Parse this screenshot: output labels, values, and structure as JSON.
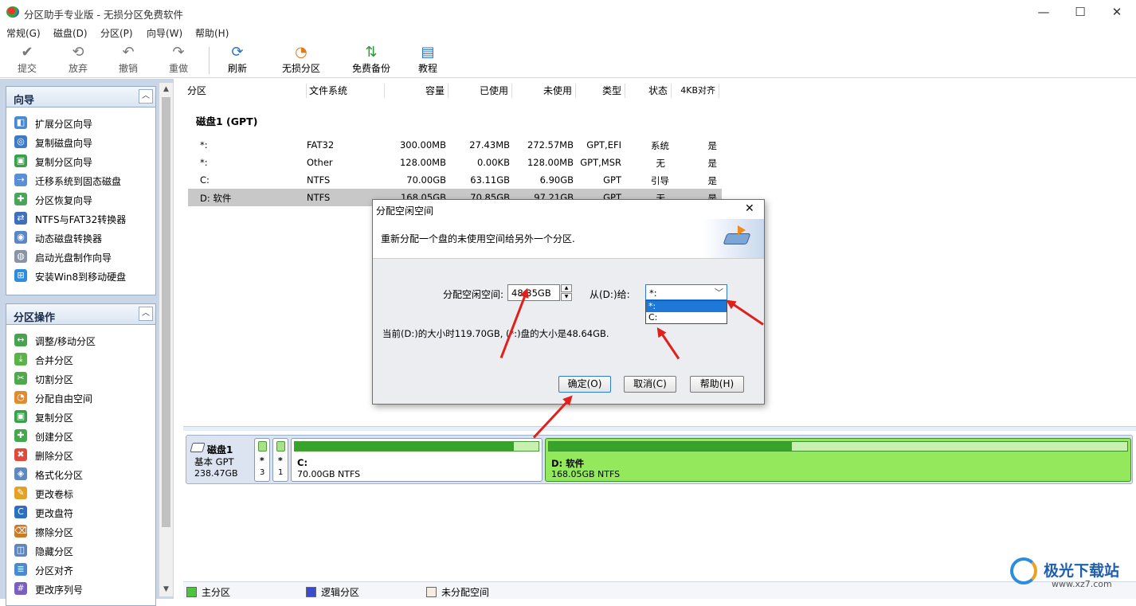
{
  "window": {
    "title": "分区助手专业版 - 无损分区免费软件",
    "min": "—",
    "max": "☐",
    "close": "✕"
  },
  "menu": [
    "常规(G)",
    "磁盘(D)",
    "分区(P)",
    "向导(W)",
    "帮助(H)"
  ],
  "toolbar": [
    {
      "label": "提交",
      "icon": "check-icon",
      "glyph": "✔",
      "enabled": false
    },
    {
      "label": "放弃",
      "icon": "discard-icon",
      "glyph": "⟲",
      "enabled": false
    },
    {
      "label": "撤销",
      "icon": "undo-icon",
      "glyph": "↶",
      "enabled": false
    },
    {
      "label": "重做",
      "icon": "redo-icon",
      "glyph": "↷",
      "enabled": false
    },
    {
      "label": "刷新",
      "icon": "refresh-icon",
      "glyph": "⟳",
      "enabled": true
    },
    {
      "label": "无损分区",
      "icon": "partition-icon",
      "glyph": "◔",
      "enabled": true
    },
    {
      "label": "免费备份",
      "icon": "backup-icon",
      "glyph": "⇅",
      "enabled": true
    },
    {
      "label": "教程",
      "icon": "tutorial-icon",
      "glyph": "▤",
      "enabled": true
    }
  ],
  "wizard_panel": {
    "title": "向导",
    "items": [
      "扩展分区向导",
      "复制磁盘向导",
      "复制分区向导",
      "迁移系统到固态磁盘",
      "分区恢复向导",
      "NTFS与FAT32转换器",
      "动态磁盘转换器",
      "启动光盘制作向导",
      "安装Win8到移动硬盘"
    ]
  },
  "ops_panel": {
    "title": "分区操作",
    "items": [
      "调整/移动分区",
      "合并分区",
      "切割分区",
      "分配自由空间",
      "复制分区",
      "创建分区",
      "删除分区",
      "格式化分区",
      "更改卷标",
      "更改盘符",
      "擦除分区",
      "隐藏分区",
      "分区对齐",
      "更改序列号"
    ]
  },
  "table": {
    "columns": [
      "分区",
      "文件系统",
      "容量",
      "已使用",
      "未使用",
      "类型",
      "状态",
      "4KB对齐"
    ],
    "disk_label": "磁盘1 (GPT)",
    "rows": [
      [
        "*:",
        "FAT32",
        "300.00MB",
        "27.43MB",
        "272.57MB",
        "GPT,EFI",
        "系统",
        "是"
      ],
      [
        "*:",
        "Other",
        "128.00MB",
        "0.00KB",
        "128.00MB",
        "GPT,MSR",
        "无",
        "是"
      ],
      [
        "C:",
        "NTFS",
        "70.00GB",
        "63.11GB",
        "6.90GB",
        "GPT",
        "引导",
        "是"
      ],
      [
        "D: 软件",
        "NTFS",
        "168.05GB",
        "70.85GB",
        "97.21GB",
        "GPT",
        "无",
        "是"
      ]
    ]
  },
  "disk_map": {
    "disk_name": "磁盘1",
    "disk_type": "基本 GPT",
    "disk_size": "238.47GB",
    "small1": {
      "star": "*",
      "num": "3"
    },
    "small2": {
      "star": "*",
      "num": "1"
    },
    "c": {
      "name": "C:",
      "info": "70.00GB NTFS",
      "used_fraction": 0.9
    },
    "d": {
      "name": "D: 软件",
      "info": "168.05GB NTFS",
      "used_fraction": 0.42
    }
  },
  "legend": [
    "主分区",
    "逻辑分区",
    "未分配空间"
  ],
  "dialog": {
    "title": "分配空闲空间",
    "description": "重新分配一个盘的未使用空间给另外一个分区.",
    "size_label": "分配空闲空间:",
    "size_value": "48.35GB",
    "from_label": "从(D:)给:",
    "select_value": "*:",
    "options": [
      "*:",
      "C:"
    ],
    "info": "当前(D:)的大小时119.70GB, (*:)盘的大小是48.64GB.",
    "ok": "确定(O)",
    "cancel": "取消(C)",
    "help": "帮助(H)"
  },
  "colors": {
    "accent": "#2a72c4",
    "primary_partition": "#93e85c",
    "arrow": "#e0201c"
  },
  "watermark": {
    "text": "极光下载站",
    "url": "www.xz7.com"
  }
}
